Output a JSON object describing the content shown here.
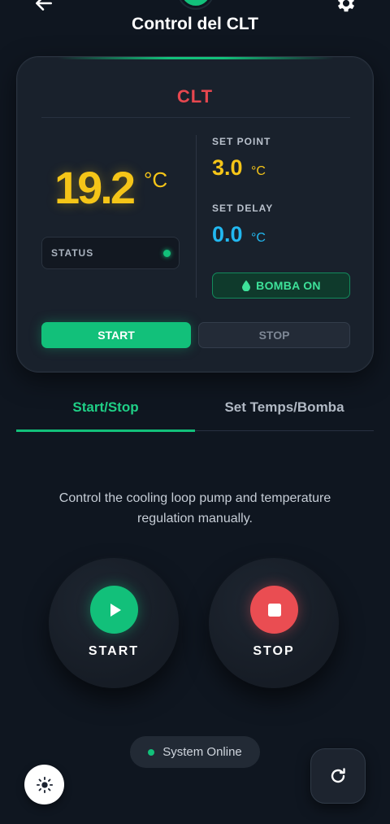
{
  "header": {
    "title": "Control del CLT",
    "back_icon": "arrow-left-icon",
    "settings_icon": "gear-icon"
  },
  "card": {
    "title": "CLT",
    "temperature": "19.2",
    "temperature_unit": "°C",
    "status_label": "STATUS",
    "status_color": "#12c07a",
    "set_point_label": "SET POINT",
    "set_point_value": "3.0",
    "set_point_unit": "°C",
    "set_delay_label": "SET DELAY",
    "set_delay_value": "0.0",
    "set_delay_unit": "°C",
    "bomba_label": "BOMBA ON",
    "start_label": "START",
    "stop_label": "STOP"
  },
  "tabs": [
    {
      "label": "Start/Stop",
      "active": true
    },
    {
      "label": "Set Temps/Bomba",
      "active": false
    }
  ],
  "main": {
    "description": "Control the cooling loop pump and temperature regulation manually.",
    "start_label": "START",
    "stop_label": "STOP"
  },
  "footer": {
    "online_label": "System Online",
    "theme_icon": "sun-icon",
    "refresh_icon": "refresh-icon"
  },
  "colors": {
    "accent_green": "#12c07a",
    "warning_yellow": "#f5c518",
    "info_blue": "#22b8f0",
    "danger_red": "#ea4d52",
    "title_red": "#e6474f",
    "background": "#0f1620"
  }
}
